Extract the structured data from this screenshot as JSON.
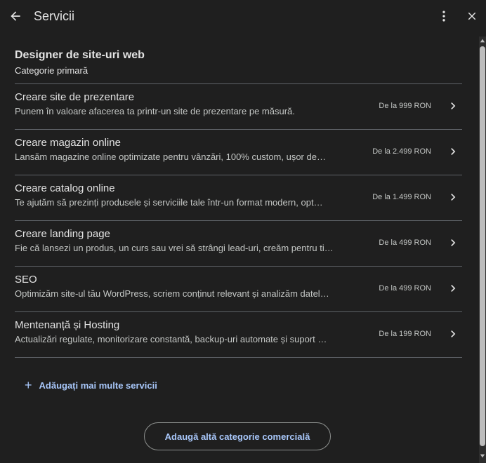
{
  "header": {
    "title": "Servicii",
    "back_icon": "arrow-left-icon",
    "more_icon": "more-vert-icon",
    "close_icon": "close-icon"
  },
  "primary_category": {
    "name": "Designer de site-uri web",
    "label": "Categorie primară"
  },
  "services": [
    {
      "title": "Creare site de prezentare",
      "description": "Punem în valoare afacerea ta printr-un site de prezentare pe măsură.",
      "price": "De la 999 RON"
    },
    {
      "title": "Creare magazin online",
      "description": "Lansăm magazine online optimizate pentru vânzări, 100% custom, ușor de…",
      "price": "De la 2.499 RON"
    },
    {
      "title": "Creare catalog online",
      "description": "Te ajutăm să prezinți produsele și serviciile tale într-un format modern, opt…",
      "price": "De la 1.499 RON"
    },
    {
      "title": "Creare landing page",
      "description": "Fie că lansezi un produs, un curs sau vrei să strângi lead-uri, creăm pentru ti…",
      "price": "De la 499 RON"
    },
    {
      "title": "SEO",
      "description": "Optimizăm site-ul tău WordPress, scriem conținut relevant și analizăm datel…",
      "price": "De la 499 RON"
    },
    {
      "title": "Mentenanță și Hosting",
      "description": "Actualizări regulate, monitorizare constantă, backup-uri automate și suport …",
      "price": "De la 199 RON"
    }
  ],
  "add_more_services": {
    "icon": "plus-icon",
    "label": "Adăugați mai multe servicii"
  },
  "add_category_button": "Adaugă altă categorie comercială",
  "colors": {
    "background": "#1f1f1f",
    "text": "#e3e3e3",
    "accent": "#a8c7fa",
    "divider": "#5f6368"
  }
}
